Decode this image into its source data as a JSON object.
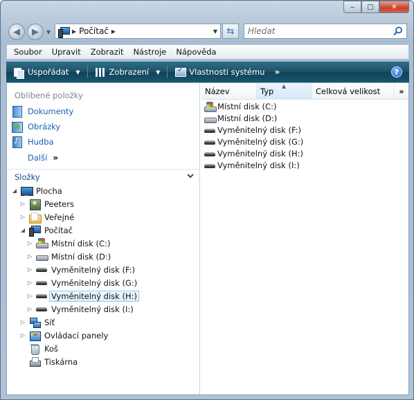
{
  "window": {
    "controls": {
      "minimize": "‒",
      "maximize": "□",
      "close": "✕"
    }
  },
  "address": {
    "location": "Počítač",
    "search_placeholder": "Hledat"
  },
  "menu": [
    "Soubor",
    "Upravit",
    "Zobrazit",
    "Nástroje",
    "Nápověda"
  ],
  "commands": {
    "organize": "Uspořádat",
    "views": "Zobrazení",
    "system_properties": "Vlastnosti systému",
    "more": "»",
    "help": "?"
  },
  "favorites": {
    "header": "Oblíbené položky",
    "items": [
      "Dokumenty",
      "Obrázky",
      "Hudba"
    ],
    "more": "Další",
    "more_arrow": "»"
  },
  "folders": {
    "header": "Složky",
    "tree": [
      {
        "label": "Plocha",
        "icon": "desktop-icon",
        "expander": "◢"
      },
      {
        "label": "Peeters",
        "icon": "user-folder-icon",
        "expander": "▷"
      },
      {
        "label": "Veřejné",
        "icon": "folder-icon",
        "expander": "▷"
      },
      {
        "label": "Počítač",
        "icon": "computer-icon",
        "expander": "◢"
      },
      {
        "label": "Místní disk (C:)",
        "icon": "windows-disk-icon",
        "expander": "▷"
      },
      {
        "label": "Místní disk (D:)",
        "icon": "hard-disk-icon",
        "expander": "▷"
      },
      {
        "label": "Vyměnitelný disk (F:)",
        "icon": "removable-disk-icon",
        "expander": "▷"
      },
      {
        "label": "Vyměnitelný disk (G:)",
        "icon": "removable-disk-icon",
        "expander": "▷"
      },
      {
        "label": "Vyměnitelný disk (H:)",
        "icon": "removable-disk-icon",
        "expander": "▷",
        "selected": true
      },
      {
        "label": "Vyměnitelný disk (I:)",
        "icon": "removable-disk-icon",
        "expander": "▷"
      },
      {
        "label": "Síť",
        "icon": "network-icon",
        "expander": "▷"
      },
      {
        "label": "Ovládací panely",
        "icon": "control-panel-icon",
        "expander": "▷"
      },
      {
        "label": "Koš",
        "icon": "recycle-bin-icon",
        "expander": ""
      },
      {
        "label": "Tiskárna",
        "icon": "printer-icon",
        "expander": ""
      }
    ]
  },
  "columns": [
    "Název",
    "Typ",
    "Celková velikost",
    "»"
  ],
  "files": [
    {
      "name": "Místní disk (C:)",
      "icon": "windows-disk-icon"
    },
    {
      "name": "Místní disk (D:)",
      "icon": "hard-disk-icon"
    },
    {
      "name": "Vyměnitelný disk (F:)",
      "icon": "removable-disk-icon"
    },
    {
      "name": "Vyměnitelný disk (G:)",
      "icon": "removable-disk-icon"
    },
    {
      "name": "Vyměnitelný disk (H:)",
      "icon": "removable-disk-icon"
    },
    {
      "name": "Vyměnitelný disk (I:)",
      "icon": "removable-disk-icon"
    }
  ],
  "colors": {
    "command_bar": "#18566f",
    "link": "#1a5fb4",
    "selection": "#dceefc"
  }
}
